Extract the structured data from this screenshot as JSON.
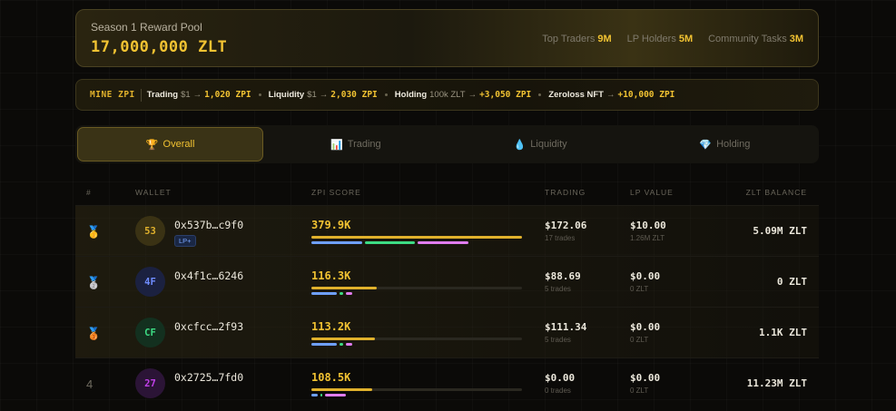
{
  "pool": {
    "label": "Season 1 Reward Pool",
    "amount": "17,000,000 ZLT",
    "stats": [
      {
        "label": "Top Traders",
        "value": "9M"
      },
      {
        "label": "LP Holders",
        "value": "5M"
      },
      {
        "label": "Community Tasks",
        "value": "3M"
      }
    ]
  },
  "mine": {
    "title": "MINE ZPI",
    "items": [
      {
        "name": "Trading",
        "input": "$1",
        "arrow": "→",
        "output": "1,020 ZPI"
      },
      {
        "name": "Liquidity",
        "input": "$1",
        "arrow": "→",
        "output": "2,030 ZPI"
      },
      {
        "name": "Holding",
        "input": "100k ZLT",
        "arrow": "→",
        "output": "+3,050 ZPI"
      },
      {
        "name": "Zeroloss NFT",
        "input": "",
        "arrow": "→",
        "output": "+10,000 ZPI"
      }
    ]
  },
  "tabs": [
    {
      "label": "Overall",
      "icon": "🏆",
      "icon_name": "trophy-icon",
      "active": true
    },
    {
      "label": "Trading",
      "icon": "📊",
      "icon_name": "bar-chart-icon",
      "active": false
    },
    {
      "label": "Liquidity",
      "icon": "💧",
      "icon_name": "droplet-icon",
      "active": false
    },
    {
      "label": "Holding",
      "icon": "💎",
      "icon_name": "gem-icon",
      "active": false
    }
  ],
  "table": {
    "headers": {
      "rank": "#",
      "wallet": "WALLET",
      "score": "ZPI SCORE",
      "trading": "TRADING",
      "lp": "LP VALUE",
      "balance": "ZLT BALANCE"
    },
    "rows": [
      {
        "rank": "🥇",
        "rank_icon": "gold-medal-icon",
        "avatar": "53",
        "avatar_color": "#e0b12c",
        "avatar_bg": "#3a3214",
        "wallet": "0x537b…c9f0",
        "badge": "LP+",
        "score": "379.9K",
        "score_fraction": 1.0,
        "sub_bars": [
          {
            "color": "#6fa0ff",
            "frac": 0.24
          },
          {
            "color": "#3ddc84",
            "frac": 0.24
          },
          {
            "color": "#e07cf0",
            "frac": 0.24
          }
        ],
        "trading": "$172.06",
        "trades": "17 trades",
        "lp": "$10.00",
        "lp_zlt": "1.26M ZLT",
        "balance": "5.09M ZLT",
        "highlight": true
      },
      {
        "rank": "🥈",
        "rank_icon": "silver-medal-icon",
        "avatar": "4F",
        "avatar_color": "#6f8cff",
        "avatar_bg": "#1b2140",
        "wallet": "0x4f1c…6246",
        "badge": "",
        "score": "116.3K",
        "score_fraction": 0.31,
        "sub_bars": [
          {
            "color": "#6fa0ff",
            "frac": 0.12
          },
          {
            "color": "#3ddc84",
            "frac": 0.02
          },
          {
            "color": "#e07cf0",
            "frac": 0.03
          }
        ],
        "trading": "$88.69",
        "trades": "5 trades",
        "lp": "$0.00",
        "lp_zlt": "0 ZLT",
        "balance": "0 ZLT",
        "highlight": true
      },
      {
        "rank": "🥉",
        "rank_icon": "bronze-medal-icon",
        "avatar": "CF",
        "avatar_color": "#3ddc84",
        "avatar_bg": "#13301f",
        "wallet": "0xcfcc…2f93",
        "badge": "",
        "score": "113.2K",
        "score_fraction": 0.3,
        "sub_bars": [
          {
            "color": "#6fa0ff",
            "frac": 0.12
          },
          {
            "color": "#3ddc84",
            "frac": 0.02
          },
          {
            "color": "#e07cf0",
            "frac": 0.03
          }
        ],
        "trading": "$111.34",
        "trades": "5 trades",
        "lp": "$0.00",
        "lp_zlt": "0 ZLT",
        "balance": "1.1K ZLT",
        "highlight": true
      },
      {
        "rank": "4",
        "rank_icon": "",
        "avatar": "27",
        "avatar_color": "#c040e8",
        "avatar_bg": "#2b1436",
        "wallet": "0x2725…7fd0",
        "badge": "",
        "score": "108.5K",
        "score_fraction": 0.29,
        "sub_bars": [
          {
            "color": "#6fa0ff",
            "frac": 0.03
          },
          {
            "color": "#3ddc84",
            "frac": 0.01
          },
          {
            "color": "#e07cf0",
            "frac": 0.1
          }
        ],
        "trading": "$0.00",
        "trades": "0 trades",
        "lp": "$0.00",
        "lp_zlt": "0 ZLT",
        "balance": "11.23M ZLT",
        "highlight": false
      }
    ]
  }
}
